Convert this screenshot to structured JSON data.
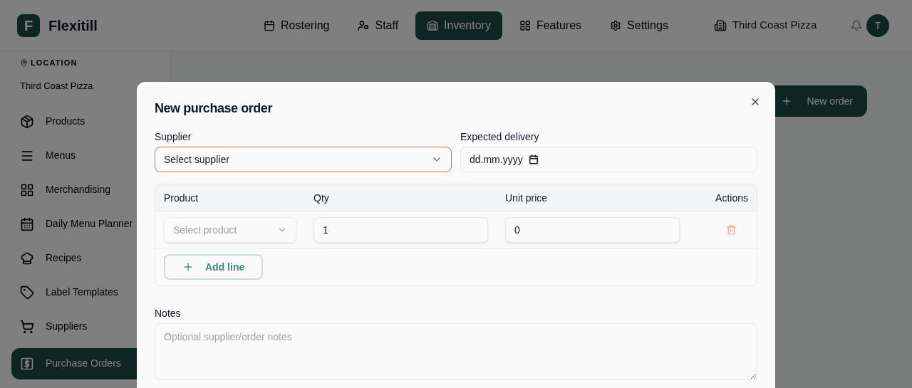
{
  "header": {
    "logo_letter": "F",
    "brand": "Flexitill",
    "nav": [
      {
        "label": "Rostering",
        "selected": false
      },
      {
        "label": "Staff",
        "selected": false
      },
      {
        "label": "Inventory",
        "selected": true
      },
      {
        "label": "Features",
        "selected": false
      },
      {
        "label": "Settings",
        "selected": false
      }
    ],
    "location": "Third Coast Pizza",
    "avatar": "T"
  },
  "sidebar": {
    "location_label": "LOCATION",
    "location_value": "Third Coast Pizza",
    "items": [
      {
        "label": "Products",
        "selected": false
      },
      {
        "label": "Menus",
        "selected": false
      },
      {
        "label": "Merchandising",
        "selected": false
      },
      {
        "label": "Daily Menu Planner",
        "selected": false
      },
      {
        "label": "Recipes",
        "selected": false
      },
      {
        "label": "Label Templates",
        "selected": false
      },
      {
        "label": "Suppliers",
        "selected": false
      },
      {
        "label": "Purchase Orders",
        "selected": true
      }
    ]
  },
  "main": {
    "new_order_button": "New order"
  },
  "dialog": {
    "title": "New purchase order",
    "supplier": {
      "label": "Supplier",
      "value": "Select supplier",
      "focused": true
    },
    "expected_delivery": {
      "label": "Expected delivery",
      "placeholder": "dd.mm.yyyy"
    },
    "table": {
      "columns": [
        "Product",
        "Qty",
        "Unit price",
        "Actions"
      ],
      "rows": [
        {
          "product": "Select product",
          "qty": "1",
          "unit_price": "0"
        }
      ],
      "add_line": "Add line"
    },
    "notes": {
      "label": "Notes",
      "placeholder": "Optional supplier/order notes"
    }
  }
}
